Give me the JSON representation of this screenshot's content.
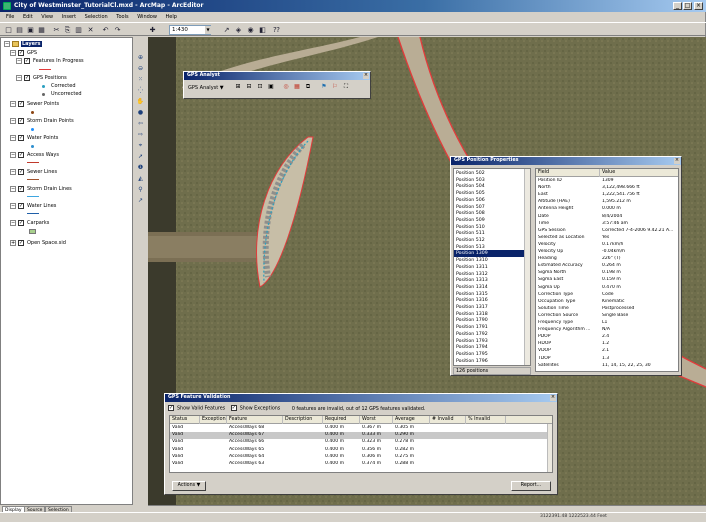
{
  "window": {
    "title": "City of Westminster_TutorialCl.mxd - ArcMap - ArcEditor",
    "minimize": "_",
    "maximize": "□",
    "close": "×"
  },
  "menu": [
    "File",
    "Edit",
    "View",
    "Insert",
    "Selection",
    "Tools",
    "Window",
    "Help"
  ],
  "toolbar": {
    "scale": "1:430",
    "scale_drop": "▼",
    "glyphs": [
      "□",
      "▤",
      "▣",
      "▦",
      "✂",
      "⎘",
      "▥",
      "✕",
      "↶",
      "↷",
      "✚",
      "↗",
      "◈",
      "◉",
      "◧",
      "⁇"
    ]
  },
  "toc": {
    "root": "Layers",
    "layers": [
      {
        "name": "GPS",
        "expanded": true
      },
      {
        "name": "Features In Progress"
      },
      {
        "name": "GPS Positions"
      },
      {
        "name": "Corrected"
      },
      {
        "name": "Uncorrected"
      },
      {
        "name": "Sewer Points"
      },
      {
        "name": "Storm Drain Points"
      },
      {
        "name": "Water Points"
      },
      {
        "name": "Access Ways"
      },
      {
        "name": "Sewer Lines"
      },
      {
        "name": "Storm Drain Lines"
      },
      {
        "name": "Water Lines"
      },
      {
        "name": "Carparks"
      },
      {
        "name": "Open Space.sid"
      }
    ],
    "tabs": [
      "Display",
      "Source",
      "Selection"
    ],
    "colors": {
      "features_in_progress": "#e23b3b",
      "corrected": "#2aa0c0",
      "uncorrected": "#666666",
      "sewer_points": "#8b4513",
      "storm_points": "#1e90ff",
      "water_points": "#2f8fcf",
      "access_ways": "#c0392b",
      "sewer_lines": "#a0522d",
      "storm_lines": "#3fa6e0",
      "water_lines": "#1f5fa8",
      "carparks": "#a8d08d"
    }
  },
  "vtools": [
    "⊕",
    "⊖",
    "⁙",
    "⁛",
    "✋",
    "●",
    "⇦",
    "⇨",
    "⌖",
    "➚",
    "❶",
    "◭",
    "⚲",
    "↗"
  ],
  "gps_analyst": {
    "title": "GPS Analyst",
    "menu_label": "GPS Analyst ▼",
    "icons": [
      "⊞",
      "⊟",
      "⊡",
      "▣",
      "◎",
      "▦",
      "⧉",
      "⚑",
      "⚐",
      "⛶"
    ],
    "close": "×"
  },
  "gps_properties": {
    "title": "GPS Position Properties",
    "close": "×",
    "list": [
      "Position 502",
      "Position 503",
      "Position 504",
      "Position 505",
      "Position 506",
      "Position 507",
      "Position 508",
      "Position 509",
      "Position 510",
      "Position 511",
      "Position 512",
      "Position 513",
      "Position 1309",
      "Position 1310",
      "Position 1311",
      "Position 1312",
      "Position 1313",
      "Position 1314",
      "Position 1315",
      "Position 1316",
      "Position 1317",
      "Position 1318",
      "Position 1790",
      "Position 1791",
      "Position 1792",
      "Position 1793",
      "Position 1794",
      "Position 1795",
      "Position 1796"
    ],
    "selected_index": 12,
    "count": "126 positions",
    "header": {
      "field": "Field",
      "value": "Value"
    },
    "rows": [
      {
        "f": "Position ID",
        "v": "1309"
      },
      {
        "f": "North",
        "v": "3,122,498.666 ft"
      },
      {
        "f": "East",
        "v": "1,222,541.756 ft"
      },
      {
        "f": "Altitude (HAE)",
        "v": "1,595.212 m"
      },
      {
        "f": "Antenna Height",
        "v": "0.000 m"
      },
      {
        "f": "Date",
        "v": "8/4/2004"
      },
      {
        "f": "Time",
        "v": "3:57:46 am"
      },
      {
        "f": "GPS Session",
        "v": "Corrected 7-4-2006 9.42.21 A..."
      },
      {
        "f": "Selected as Location",
        "v": "Yes"
      },
      {
        "f": "Velocity",
        "v": "0.17km/h"
      },
      {
        "f": "Velocity Up",
        "v": "-0.04km/h"
      },
      {
        "f": "Heading",
        "v": "226° (T)"
      },
      {
        "f": "Estimated Accuracy",
        "v": "0.264 m"
      },
      {
        "f": "Sigma North",
        "v": "0.198 m"
      },
      {
        "f": "Sigma East",
        "v": "0.159 m"
      },
      {
        "f": "Sigma Up",
        "v": "0.470 m"
      },
      {
        "f": "Correction Type",
        "v": "Code"
      },
      {
        "f": "Occupation Type",
        "v": "Kinematic"
      },
      {
        "f": "Solution Time",
        "v": "Postprocessed"
      },
      {
        "f": "Correction Source",
        "v": "Single Base"
      },
      {
        "f": "Frequency Type",
        "v": "L1"
      },
      {
        "f": "Frequency Algorithm ...",
        "v": "N/A"
      },
      {
        "f": "PDOP",
        "v": "2.4"
      },
      {
        "f": "HDOP",
        "v": "1.2"
      },
      {
        "f": "VDOP",
        "v": "2.1"
      },
      {
        "f": "TDOP",
        "v": "1.3"
      },
      {
        "f": "Satellites",
        "v": "11, 14, 15, 22, 25, 30"
      }
    ]
  },
  "gps_validation": {
    "title": "GPS Feature Validation",
    "show_valid": "Show Valid Features",
    "show_exceptions": "Show Exceptions",
    "summary": "0 features are invalid, out of 12 GPS features validated.",
    "check": "✓",
    "columns": [
      "Status",
      "Exception",
      "Feature",
      "Description",
      "Required",
      "Worst",
      "Average",
      "# Invalid",
      "% Invalid"
    ],
    "rows": [
      {
        "status": "Valid",
        "feature": "AccessWays 68",
        "required": "0.400 m",
        "worst": "0.367 m",
        "average": "0.305 m"
      },
      {
        "status": "Valid",
        "feature": "AccessWays 67",
        "required": "0.400 m",
        "worst": "0.333 m",
        "average": "0.290 m"
      },
      {
        "status": "Valid",
        "feature": "AccessWays 66",
        "required": "0.400 m",
        "worst": "0.323 m",
        "average": "0.278 m"
      },
      {
        "status": "Valid",
        "feature": "AccessWays 65",
        "required": "0.400 m",
        "worst": "0.356 m",
        "average": "0.282 m"
      },
      {
        "status": "Valid",
        "feature": "AccessWays 64",
        "required": "0.400 m",
        "worst": "0.306 m",
        "average": "0.275 m"
      },
      {
        "status": "Valid",
        "feature": "AccessWays 63",
        "required": "0.400 m",
        "worst": "0.374 m",
        "average": "0.288 m"
      }
    ],
    "actions": "Actions ▼",
    "report": "Report..."
  },
  "status": {
    "coords": "3122391.48  1222523.44 Feet"
  }
}
